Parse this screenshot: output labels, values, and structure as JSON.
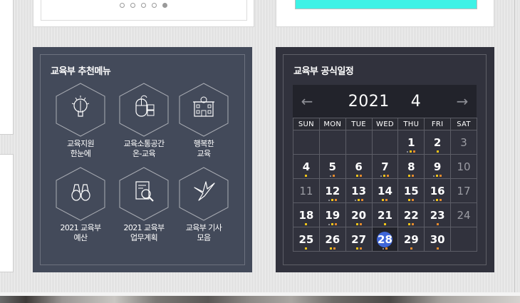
{
  "slider_dots": [
    false,
    false,
    false,
    false,
    true
  ],
  "colors": {
    "cyan_banner": "#3ef2e6",
    "menu_panel_bg": "#434a5a",
    "calendar_panel_bg": "#31323d",
    "today_highlight": "#3f66d8",
    "event_mark_yellow": "#f0c419",
    "event_mark_orange": "#e58a2d"
  },
  "menu": {
    "title": "교육부 추천메뉴",
    "items": [
      {
        "label": "교육지원\n한눈에",
        "icon": "idea-pen-icon"
      },
      {
        "label": "교육소통공간\n온-교육",
        "icon": "mouse-learning-icon"
      },
      {
        "label": "행복한\n교육",
        "icon": "school-building-icon"
      },
      {
        "label": "2021 교육부\n예산",
        "icon": "binoculars-icon"
      },
      {
        "label": "2021 교육부\n업무계획",
        "icon": "document-search-icon"
      },
      {
        "label": "교육부 기사\n모음",
        "icon": "paper-crane-icon"
      }
    ]
  },
  "calendar": {
    "title": "교육부 공식일정",
    "year": "2021",
    "month": "4",
    "prev_icon": "←",
    "next_icon": "→",
    "weekdays": [
      "SUN",
      "MON",
      "TUE",
      "WED",
      "THU",
      "FRI",
      "SAT"
    ],
    "weeks": [
      [
        {
          "d": ""
        },
        {
          "d": ""
        },
        {
          "d": ""
        },
        {
          "d": ""
        },
        {
          "d": "1",
          "m": "gyo"
        },
        {
          "d": "2",
          "m": "y"
        },
        {
          "d": "3",
          "gray": true
        }
      ],
      [
        {
          "d": "4",
          "m": "y"
        },
        {
          "d": "5",
          "m": "go"
        },
        {
          "d": "6",
          "m": "yo"
        },
        {
          "d": "7",
          "m": "gyo"
        },
        {
          "d": "8",
          "m": "yo"
        },
        {
          "d": "9",
          "m": "gyo"
        },
        {
          "d": "10",
          "gray": true
        }
      ],
      [
        {
          "d": "11",
          "gray": true
        },
        {
          "d": "12",
          "m": "gyo"
        },
        {
          "d": "13",
          "m": "gyo"
        },
        {
          "d": "14",
          "m": "yo"
        },
        {
          "d": "15",
          "m": "yo"
        },
        {
          "d": "16",
          "m": "gyo"
        },
        {
          "d": "17",
          "gray": true
        }
      ],
      [
        {
          "d": "18",
          "m": "y"
        },
        {
          "d": "19",
          "m": "gyo"
        },
        {
          "d": "20",
          "m": "yo"
        },
        {
          "d": "21",
          "m": "y"
        },
        {
          "d": "22",
          "m": "yo"
        },
        {
          "d": "23",
          "m": "o"
        },
        {
          "d": "24",
          "gray": true
        }
      ],
      [
        {
          "d": "25",
          "m": "y"
        },
        {
          "d": "26",
          "m": "yo"
        },
        {
          "d": "27",
          "m": "yo"
        },
        {
          "d": "28",
          "today": true,
          "m": "go"
        },
        {
          "d": "29",
          "m": "o"
        },
        {
          "d": "30",
          "m": "o"
        },
        {
          "d": ""
        }
      ]
    ]
  }
}
